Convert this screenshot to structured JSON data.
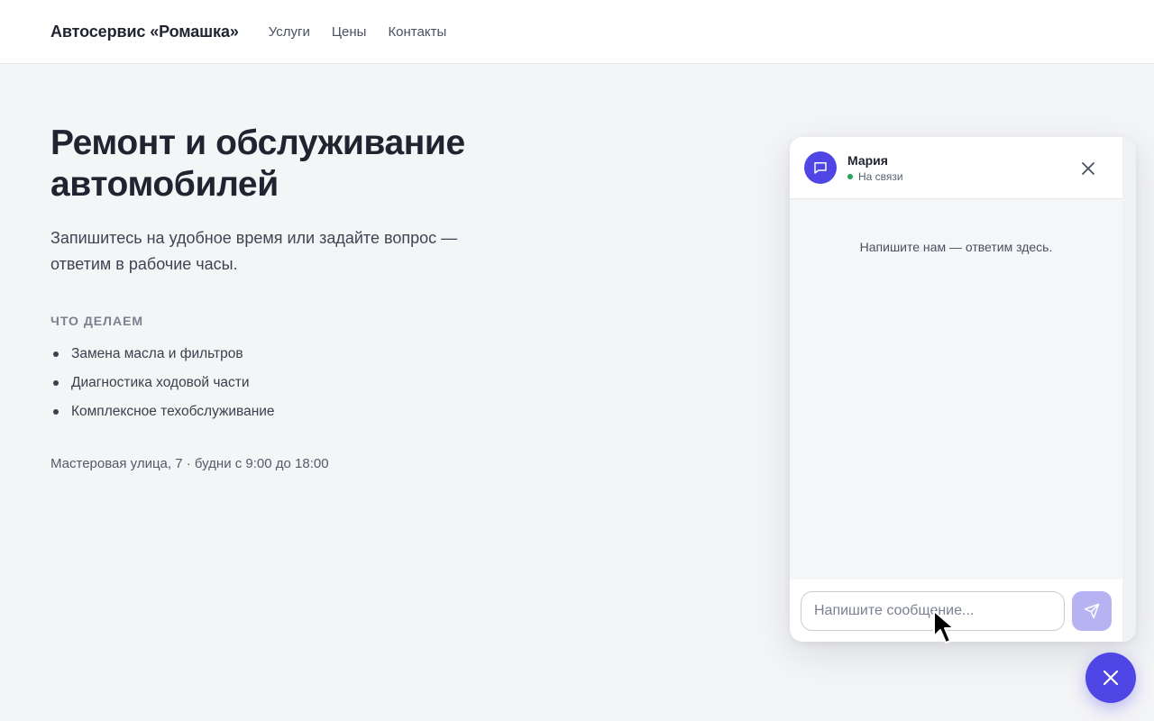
{
  "header": {
    "brand": "Автосервис «Ромашка»",
    "nav": [
      {
        "label": "Услуги"
      },
      {
        "label": "Цены"
      },
      {
        "label": "Контакты"
      }
    ]
  },
  "hero": {
    "title": "Ремонт и обслуживание автомобилей",
    "lead": "Запишитесь на удобное время или задайте вопрос — ответим в рабочие часы.",
    "section_title": "Что делаем",
    "services": [
      "Замена масла и фильтров",
      "Диагностика ходовой части",
      "Комплексное техобслуживание"
    ],
    "address": "Мастеровая улица, 7 · будни с 9:00 до 18:00"
  },
  "chat": {
    "agent_name": "Мария",
    "status": "На связи",
    "empty_text": "Напишите нам — ответим здесь.",
    "input_placeholder": "Напишите сообщение...",
    "input_value": "",
    "icons": {
      "avatar": "chat-bubble-icon",
      "close": "close-icon",
      "send": "send-icon"
    }
  },
  "fab": {
    "icon": "close-icon"
  },
  "colors": {
    "accent": "#4f46e5",
    "send_disabled": "#b7b3f2",
    "status_online": "#22a55a",
    "page_bg": "#f4f5f7"
  }
}
